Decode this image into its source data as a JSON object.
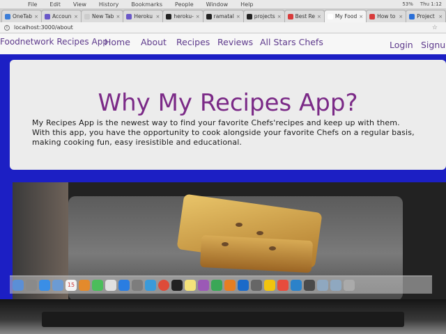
{
  "menubar": {
    "items": [
      "File",
      "Edit",
      "View",
      "History",
      "Bookmarks",
      "People",
      "Window",
      "Help"
    ],
    "battery": "53%",
    "clock": "Thu 1:12"
  },
  "tabs": [
    {
      "label": "OneTab",
      "color": "#3b7dd8",
      "active": false
    },
    {
      "label": "Accoun",
      "color": "#6a58c9",
      "active": false
    },
    {
      "label": "New Tab",
      "color": "#cccccc",
      "active": false
    },
    {
      "label": "Heroku",
      "color": "#6a58c9",
      "active": false
    },
    {
      "label": "heroku-",
      "color": "#222222",
      "active": false
    },
    {
      "label": "ramatal",
      "color": "#222222",
      "active": false
    },
    {
      "label": "projects",
      "color": "#222222",
      "active": false
    },
    {
      "label": "Best Re",
      "color": "#d83b3b",
      "active": false
    },
    {
      "label": "My Food",
      "color": "#ffffff",
      "active": true
    },
    {
      "label": "How to",
      "color": "#d83b3b",
      "active": false
    },
    {
      "label": "Project",
      "color": "#2a6fd8",
      "active": false
    }
  ],
  "browser": {
    "url": "localhost:3000/about"
  },
  "nav": {
    "brand": "Foodnetwork Recipes App",
    "home": "Home",
    "about": "About",
    "recipes": "Recipes",
    "reviews": "Reviews",
    "chefs": "All Stars Chefs",
    "login": "Login",
    "signup": "Signup"
  },
  "hero": {
    "title": "Why My Recipes App?",
    "line1": "My Recipes App is the newest way to find your favorite Chefs'recipes and keep up with them.",
    "line2": "With this app, you have the opportunity to cook alongside your favorite Chefs on a regular basis,",
    "line3": " making cooking fun, easy iresistible and educational."
  },
  "dock": {
    "calendar_day": "15"
  }
}
